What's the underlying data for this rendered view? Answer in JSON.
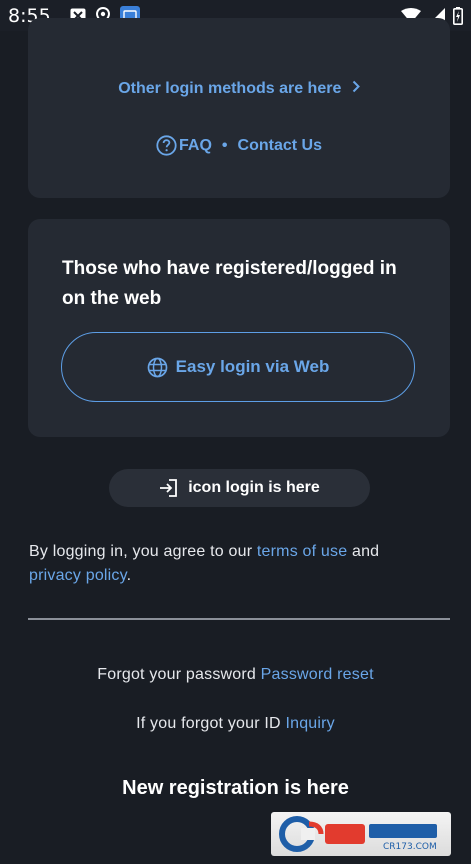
{
  "status_bar": {
    "time": "8:55",
    "left_icons": [
      "close-box-icon",
      "location-pin-icon",
      "app-badge-icon"
    ],
    "right_icons": [
      "wifi-icon",
      "signal-icon",
      "battery-icon"
    ]
  },
  "login_card": {
    "other_methods": "Other login methods are here",
    "faq": "FAQ",
    "separator": "•",
    "contact": "Contact Us"
  },
  "web_card": {
    "heading": "Those who have registered/logged in on the web",
    "button_label": "Easy login via Web"
  },
  "icon_login": {
    "label": "icon login is here"
  },
  "terms": {
    "prefix": "By logging in, you agree to our ",
    "terms_link": "terms of use",
    "middle": " and",
    "privacy_link": "privacy policy",
    "suffix": "."
  },
  "forgot_password": {
    "text": "Forgot your password ",
    "link": "Password reset"
  },
  "forgot_id": {
    "text": "If you forgot your ID ",
    "link": "Inquiry"
  },
  "new_registration": "New registration is here",
  "watermark": "CR173.COM",
  "colors": {
    "background": "#191d24",
    "card": "#252a33",
    "accent": "#6aa6e8",
    "text": "#e8eaee"
  }
}
